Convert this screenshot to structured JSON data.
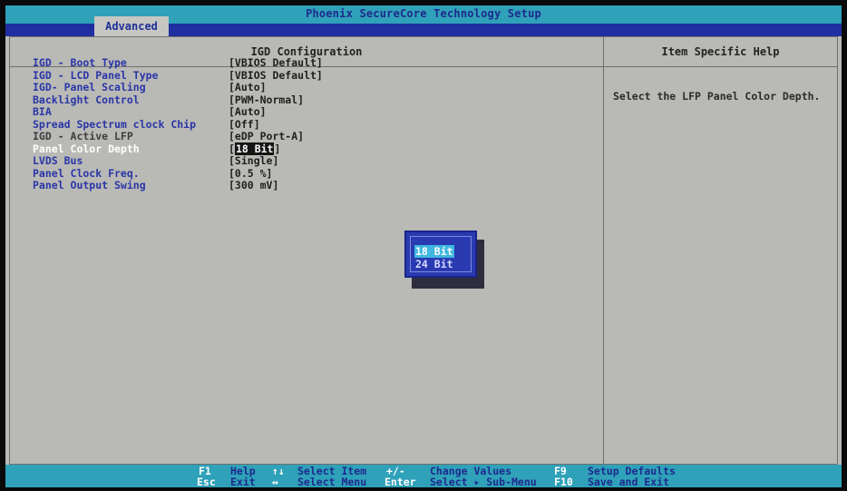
{
  "title": "Phoenix SecureCore Technology Setup",
  "tab": "Advanced",
  "left_header": "IGD Configuration",
  "right_header": "Item Specific Help",
  "help_text": "Select the LFP Panel Color Depth.",
  "settings": [
    {
      "label": "IGD - Boot Type",
      "value": "[VBIOS Default]"
    },
    {
      "label": "IGD - LCD Panel Type",
      "value": "[VBIOS Default]"
    },
    {
      "label": "IGD- Panel Scaling",
      "value": "[Auto]"
    },
    {
      "label": "Backlight Control",
      "value": "[PWM-Normal]"
    },
    {
      "label": "BIA",
      "value": "[Auto]"
    },
    {
      "label": "Spread Spectrum clock Chip",
      "value": "[Off]"
    },
    {
      "label": "IGD - Active LFP",
      "value": "[eDP Port-A]"
    },
    {
      "label": "Panel Color Depth",
      "value": "18 Bit",
      "value_open": "[",
      "value_close": "]"
    },
    {
      "label": "LVDS Bus",
      "value": "[Single]"
    },
    {
      "label": "Panel Clock Freq.",
      "value": "[0.5 %]"
    },
    {
      "label": "Panel Output Swing",
      "value": "[300 mV]"
    }
  ],
  "popup": {
    "options": [
      "18 Bit",
      "24 Bit"
    ],
    "selected": "18 Bit"
  },
  "footer": {
    "f1": "F1",
    "help": "Help",
    "updown": "↑↓",
    "select_item": "Select Item",
    "plusminus": "+/-",
    "change_values": "Change Values",
    "f9": "F9",
    "setup_defaults": "Setup Defaults",
    "esc": "Esc",
    "exit": "Exit",
    "leftright": "↔",
    "select_menu": "Select Menu",
    "enter": "Enter",
    "select_submenu": "Select ▸ Sub-Menu",
    "f10": "F10",
    "save_exit": "Save and Exit"
  },
  "colors": {
    "title_bar": "#2fa1b9",
    "blue_band": "#1f2fa0",
    "background": "#b9b9b6",
    "label_blue": "#2a36a6",
    "popup": "#2a3ab0"
  }
}
